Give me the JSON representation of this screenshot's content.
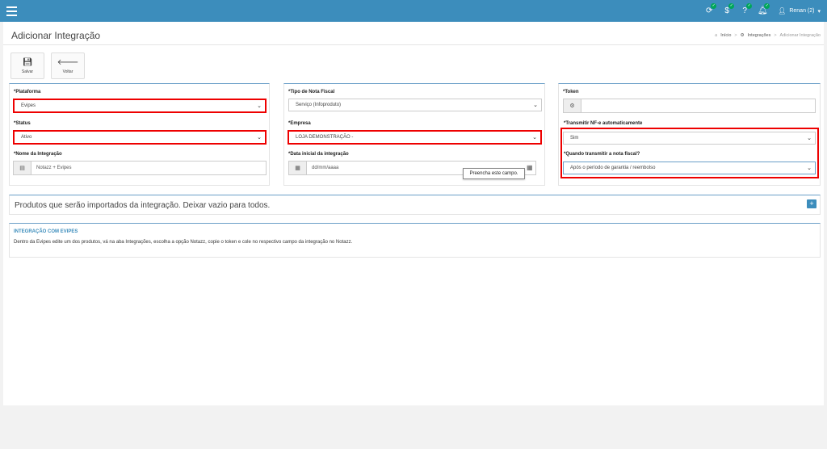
{
  "topbar": {
    "user_label": "Renan (2)",
    "accent": "#3c8dbc"
  },
  "page": {
    "title": "Adicionar Integração",
    "breadcrumb": [
      "Início",
      "Integrações",
      "Adicionar Integração"
    ]
  },
  "toolbar": {
    "save_label": "Salvar",
    "back_label": "Voltar"
  },
  "form": {
    "plataforma_label": "*Plataforma",
    "plataforma_value": "Evipes",
    "status_label": "*Status",
    "status_value": "Ativo",
    "nome_label": "*Nome da Integração",
    "nome_value": "Notazz + Evipes",
    "tipo_label": "*Tipo de Nota Fiscal",
    "tipo_value": "Serviço (Infoproduto)",
    "empresa_label": "*Empresa",
    "empresa_value": "LOJA DEMONSTRAÇÃO -",
    "data_label": "*Data inicial da integração",
    "data_placeholder": "dd/mm/aaaa",
    "token_label": "*Token",
    "token_value": "",
    "transmitir_label": "*Transmitir NF-e automaticamente",
    "transmitir_value": "Sim",
    "quando_label": "*Quando transmitir a nota fiscal?",
    "quando_value": "Após o período de garantia / reembolso",
    "tooltip": "Preencha este campo."
  },
  "products": {
    "title": "Produtos que serão importados da integração. Deixar vazio para todos."
  },
  "info": {
    "title": "INTEGRAÇÃO COM EVIPES",
    "text": "Dentro da Evipes edite um dos produtos, vá na aba Integrações, escolha a opção Notazz, copie o token e cole no respectivo campo da integração no Notazz."
  },
  "icons": [
    "menu-icon",
    "refresh-icon",
    "dollar-icon",
    "help-icon",
    "bell-icon",
    "user-icon",
    "home-icon",
    "cogs-icon",
    "save-icon",
    "arrow-left-icon",
    "id-card-icon",
    "calendar-icon",
    "plus-icon"
  ]
}
